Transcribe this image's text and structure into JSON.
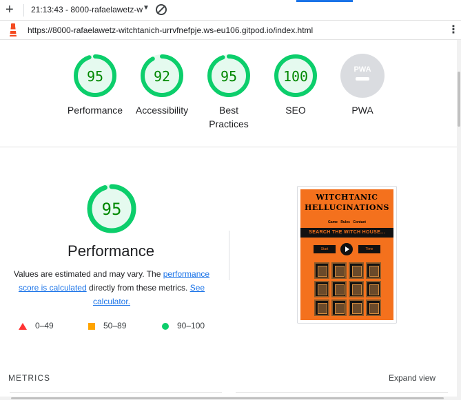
{
  "toolbar": {
    "new_tab_icon": "plus-icon",
    "session_label": "21:13:43 - 8000-rafaelawetz-w",
    "dropdown_icon": "caret-down-icon",
    "clear_icon": "block-icon"
  },
  "address": {
    "url": "https://8000-rafaelawetz-witchtanich-urrvfnefpje.ws-eu106.gitpod.io/index.html",
    "site_icon": "lighthouse-icon",
    "menu_icon": "kebab-menu-icon"
  },
  "gauges": [
    {
      "score": "95",
      "label": "Performance",
      "fraction": 0.95
    },
    {
      "score": "92",
      "label": "Accessibility",
      "fraction": 0.92
    },
    {
      "score": "95",
      "label": "Best Practices",
      "label_line1": "Best",
      "label_line2": "Practices",
      "fraction": 0.95
    },
    {
      "score": "100",
      "label": "SEO",
      "fraction": 1.0
    },
    {
      "score": "PWA",
      "label": "PWA",
      "fraction": 0
    }
  ],
  "performance": {
    "score": "95",
    "fraction": 0.95,
    "title": "Performance",
    "desc_part1": "Values are estimated and may vary. The ",
    "link1": "performance score is calculated",
    "desc_part2": " directly from these metrics. ",
    "link2": "See calculator."
  },
  "legend": [
    {
      "range": "0–49",
      "shape": "triangle",
      "color": "#ff3333"
    },
    {
      "range": "50–89",
      "shape": "square",
      "color": "#ffa400"
    },
    {
      "range": "90–100",
      "shape": "circle",
      "color": "#0cce6b"
    }
  ],
  "screenshot": {
    "title_line1": "WITCHTANIC",
    "title_line2": "HELLUCINATIONS",
    "nav": "Game Rules Contact",
    "banner": "SEARCH THE WITCH HOUSE...",
    "start": "Start",
    "time": "Time"
  },
  "metrics": {
    "heading": "METRICS",
    "expand": "Expand view"
  },
  "colors": {
    "pass": "#0cce6b",
    "pass_text": "#008800",
    "pass_fill": "#e5faef",
    "pwa_grey": "#dadce0",
    "link": "#1a73e8"
  }
}
